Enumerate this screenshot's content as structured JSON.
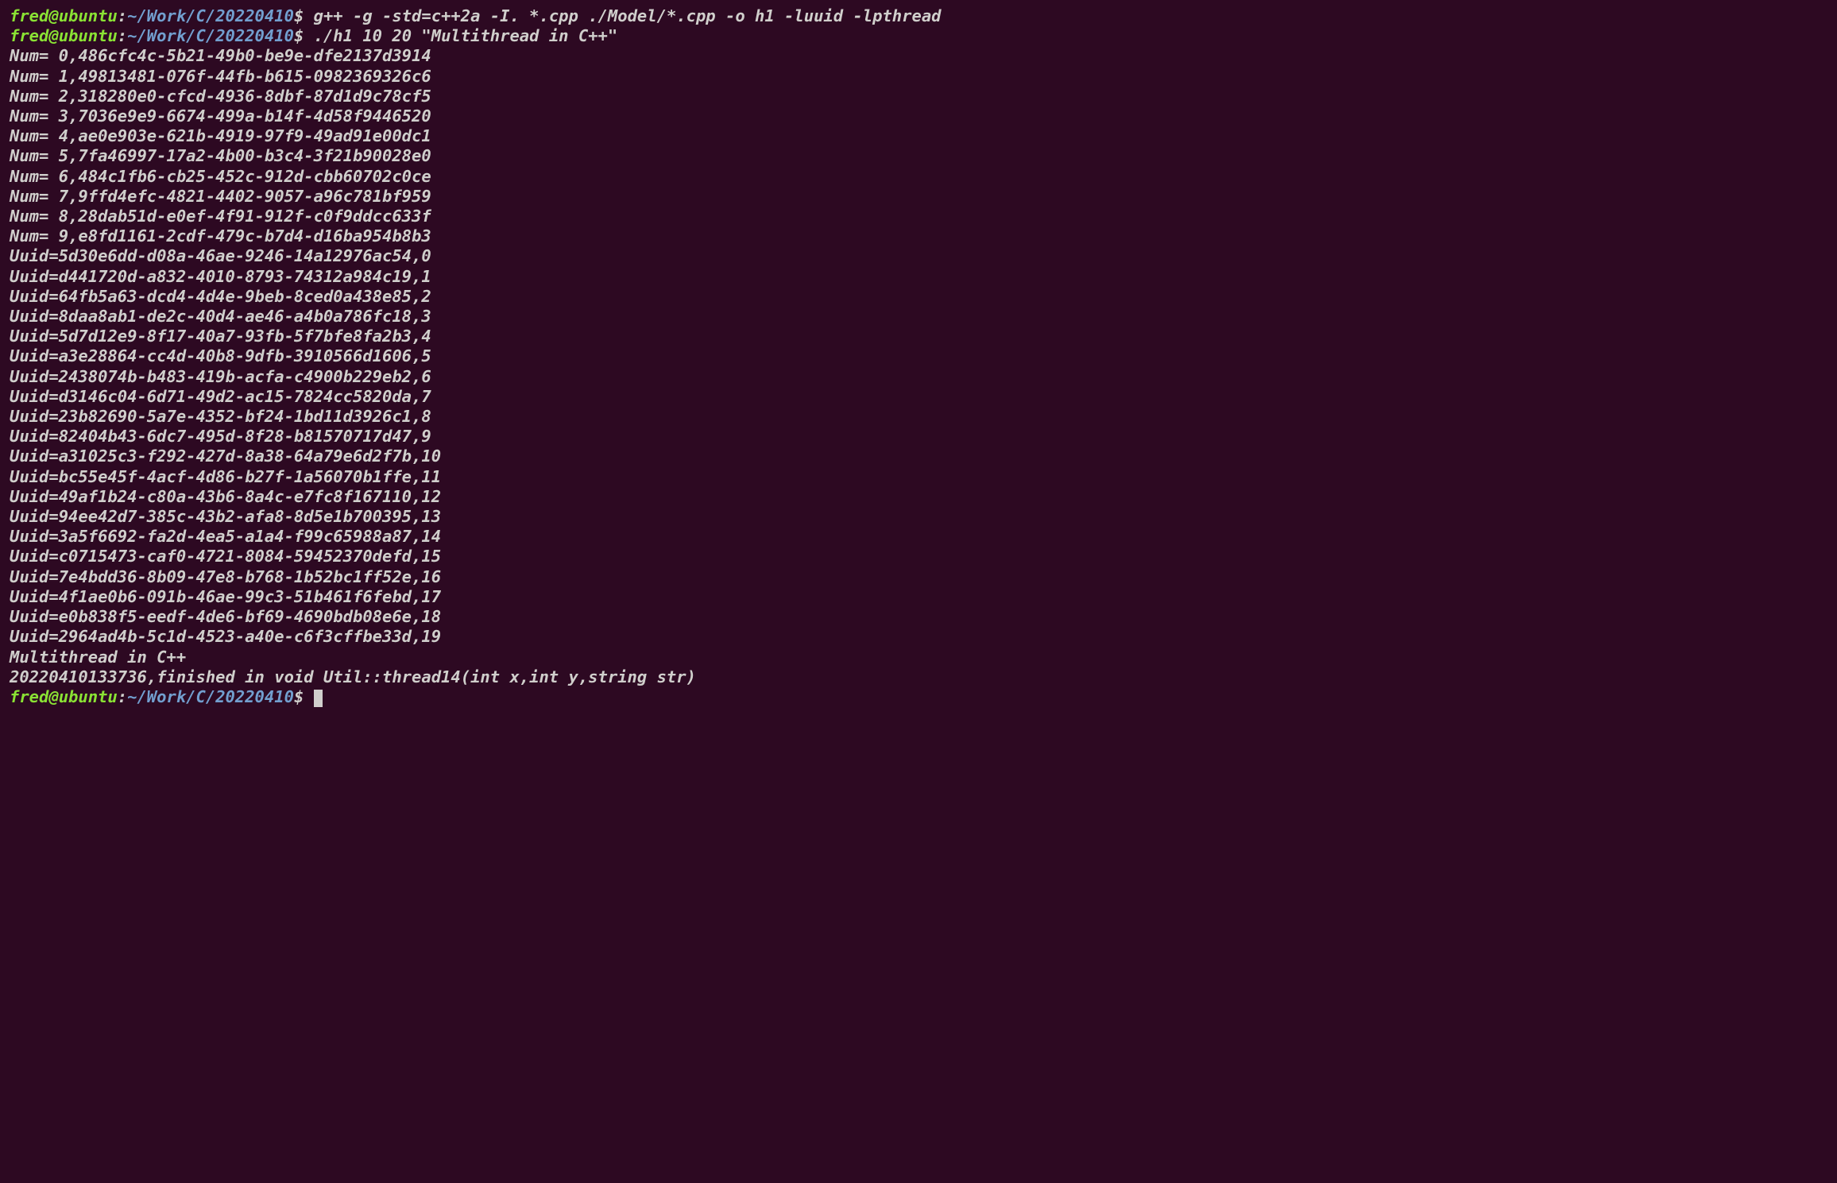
{
  "prompt": {
    "user": "fred@ubuntu",
    "sep": ":",
    "path": "~/Work/C/20220410",
    "dollar": "$"
  },
  "lines": [
    {
      "type": "prompt",
      "cmd": "g++ -g -std=c++2a -I. *.cpp ./Model/*.cpp -o h1 -luuid -lpthread"
    },
    {
      "type": "prompt",
      "cmd": "./h1 10 20 \"Multithread in C++\""
    },
    {
      "type": "out",
      "text": "Num= 0,486cfc4c-5b21-49b0-be9e-dfe2137d3914"
    },
    {
      "type": "out",
      "text": "Num= 1,49813481-076f-44fb-b615-0982369326c6"
    },
    {
      "type": "out",
      "text": "Num= 2,318280e0-cfcd-4936-8dbf-87d1d9c78cf5"
    },
    {
      "type": "out",
      "text": "Num= 3,7036e9e9-6674-499a-b14f-4d58f9446520"
    },
    {
      "type": "out",
      "text": "Num= 4,ae0e903e-621b-4919-97f9-49ad91e00dc1"
    },
    {
      "type": "out",
      "text": "Num= 5,7fa46997-17a2-4b00-b3c4-3f21b90028e0"
    },
    {
      "type": "out",
      "text": "Num= 6,484c1fb6-cb25-452c-912d-cbb60702c0ce"
    },
    {
      "type": "out",
      "text": "Num= 7,9ffd4efc-4821-4402-9057-a96c781bf959"
    },
    {
      "type": "out",
      "text": "Num= 8,28dab51d-e0ef-4f91-912f-c0f9ddcc633f"
    },
    {
      "type": "out",
      "text": "Num= 9,e8fd1161-2cdf-479c-b7d4-d16ba954b8b3"
    },
    {
      "type": "out",
      "text": "Uuid=5d30e6dd-d08a-46ae-9246-14a12976ac54,0"
    },
    {
      "type": "out",
      "text": "Uuid=d441720d-a832-4010-8793-74312a984c19,1"
    },
    {
      "type": "out",
      "text": "Uuid=64fb5a63-dcd4-4d4e-9beb-8ced0a438e85,2"
    },
    {
      "type": "out",
      "text": "Uuid=8daa8ab1-de2c-40d4-ae46-a4b0a786fc18,3"
    },
    {
      "type": "out",
      "text": "Uuid=5d7d12e9-8f17-40a7-93fb-5f7bfe8fa2b3,4"
    },
    {
      "type": "out",
      "text": "Uuid=a3e28864-cc4d-40b8-9dfb-3910566d1606,5"
    },
    {
      "type": "out",
      "text": "Uuid=2438074b-b483-419b-acfa-c4900b229eb2,6"
    },
    {
      "type": "out",
      "text": "Uuid=d3146c04-6d71-49d2-ac15-7824cc5820da,7"
    },
    {
      "type": "out",
      "text": "Uuid=23b82690-5a7e-4352-bf24-1bd11d3926c1,8"
    },
    {
      "type": "out",
      "text": "Uuid=82404b43-6dc7-495d-8f28-b81570717d47,9"
    },
    {
      "type": "out",
      "text": "Uuid=a31025c3-f292-427d-8a38-64a79e6d2f7b,10"
    },
    {
      "type": "out",
      "text": "Uuid=bc55e45f-4acf-4d86-b27f-1a56070b1ffe,11"
    },
    {
      "type": "out",
      "text": "Uuid=49af1b24-c80a-43b6-8a4c-e7fc8f167110,12"
    },
    {
      "type": "out",
      "text": "Uuid=94ee42d7-385c-43b2-afa8-8d5e1b700395,13"
    },
    {
      "type": "out",
      "text": "Uuid=3a5f6692-fa2d-4ea5-a1a4-f99c65988a87,14"
    },
    {
      "type": "out",
      "text": "Uuid=c0715473-caf0-4721-8084-59452370defd,15"
    },
    {
      "type": "out",
      "text": "Uuid=7e4bdd36-8b09-47e8-b768-1b52bc1ff52e,16"
    },
    {
      "type": "out",
      "text": "Uuid=4f1ae0b6-091b-46ae-99c3-51b461f6febd,17"
    },
    {
      "type": "out",
      "text": "Uuid=e0b838f5-eedf-4de6-bf69-4690bdb08e6e,18"
    },
    {
      "type": "out",
      "text": "Uuid=2964ad4b-5c1d-4523-a40e-c6f3cffbe33d,19"
    },
    {
      "type": "out",
      "text": "Multithread in C++"
    },
    {
      "type": "out",
      "text": "20220410133736,finished in void Util::thread14(int x,int y,string str)"
    },
    {
      "type": "prompt",
      "cmd": "",
      "cursor": true
    }
  ]
}
